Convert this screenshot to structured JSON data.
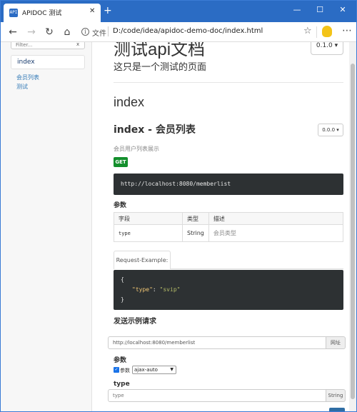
{
  "browser": {
    "tab_title": "APIDOC 测试",
    "tab_favicon_text": "API",
    "address_scheme": "文件",
    "address_url": "D:/code/idea/apidoc-demo-doc/index.html"
  },
  "sidebar": {
    "filter_placeholder": "Filter...",
    "filter_clear": "x",
    "active_item": "index",
    "links": [
      "会员列表",
      "测试"
    ]
  },
  "header": {
    "title": "测试api文档",
    "subtitle": "这只是一个测试的页面",
    "version": "0.1.0 ▾"
  },
  "section": {
    "group_title": "index",
    "endpoint_title": "index - 会员列表",
    "endpoint_version": "0.0.0 ▾",
    "description": "会员用户列表展示",
    "method": "GET",
    "url": "http://localhost:8080/memberlist"
  },
  "params": {
    "heading": "参数",
    "columns": [
      "字段",
      "类型",
      "描述"
    ],
    "rows": [
      {
        "field": "type",
        "type": "String",
        "desc": "会员类型"
      }
    ]
  },
  "example": {
    "tab_label": "Request-Example:",
    "line1": "{",
    "key": "\"type\"",
    "colon": ": ",
    "value": "\"svip\"",
    "line3": "}"
  },
  "send": {
    "heading": "发送示例请求",
    "url_value": "http://localhost:8080/memberlist",
    "url_addon": "网址",
    "params_heading": "参数",
    "checkbox_label": "参数",
    "select_value": "ajax-auto",
    "field_label": "type",
    "field_placeholder": "type",
    "field_addon": "String"
  }
}
